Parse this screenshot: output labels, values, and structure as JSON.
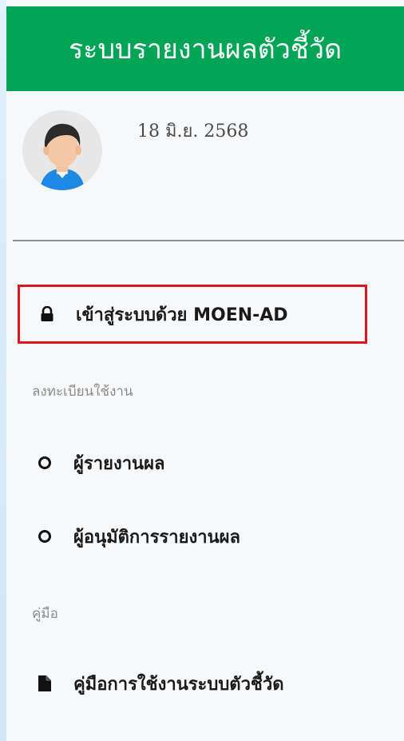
{
  "brand": {
    "title": "ระบบรายงานผลตัวชี้วัด"
  },
  "user": {
    "date": "18 มิ.ย. 2568"
  },
  "nav": {
    "login_label": "เข้าสู่ระบบด้วย MOEN-AD",
    "register_header": "ลงทะเบียนใช้งาน",
    "items": [
      {
        "label": "ผู้รายงานผล",
        "icon": "circle-icon"
      },
      {
        "label": "ผู้อนุมัติการรายงานผล",
        "icon": "circle-icon"
      }
    ],
    "manual_header": "คู่มือ",
    "manual_label": "คู่มือการใช้งานระบบตัวชี้วัด"
  },
  "colors": {
    "brand": "#02a556",
    "highlight_border": "#e0141c"
  }
}
